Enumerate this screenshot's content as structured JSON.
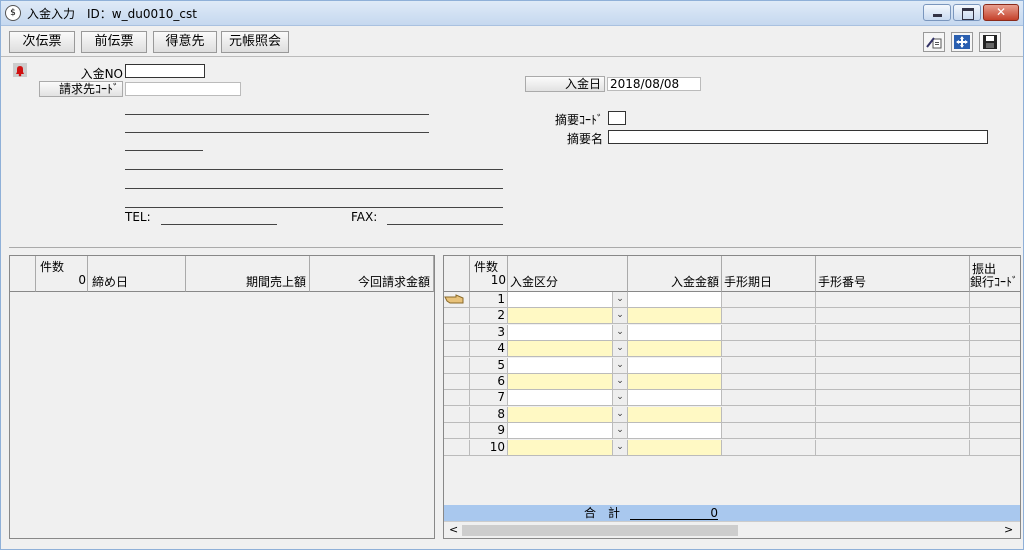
{
  "window": {
    "title": "入金入力　ID：w_du0010_cst",
    "close_glyph": "✕"
  },
  "toolbar": {
    "buttons": [
      "次伝票",
      "前伝票",
      "得意先",
      "元帳照会"
    ]
  },
  "header": {
    "nyukin_no_label": "入金NO",
    "seikyu_code_label": "請求先ｺｰﾄﾞ",
    "nyukin_date_label": "入金日",
    "nyukin_date_value": "2018/08/08",
    "tekiyo_code_label": "摘要ｺｰﾄﾞ",
    "tekiyo_name_label": "摘要名",
    "tel_label": "TEL:",
    "fax_label": "FAX:"
  },
  "left_grid": {
    "columns": [
      "件数",
      "締め日",
      "期間売上額",
      "今回請求金額"
    ],
    "count": "0"
  },
  "right_grid": {
    "columns": [
      "件数",
      "入金区分",
      "入金金額",
      "手形期日",
      "手形番号",
      "振出",
      "銀行ｺｰﾄﾞ"
    ],
    "count": "10",
    "rows": [
      "1",
      "2",
      "3",
      "4",
      "5",
      "6",
      "7",
      "8",
      "9",
      "10"
    ],
    "total_label": "合　計",
    "total_value": "0",
    "scroll_left": "<",
    "scroll_right": ">"
  },
  "icons": [
    "app-icon",
    "minimize-icon",
    "maximize-icon",
    "close-icon",
    "bell-icon",
    "pointer-hand-icon",
    "edit-icon",
    "fit-icon",
    "save-icon"
  ]
}
